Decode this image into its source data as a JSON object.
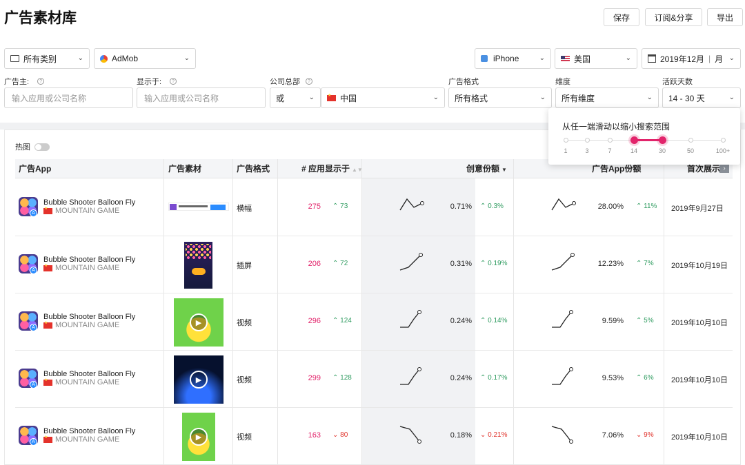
{
  "page_title": "广告素材库",
  "toolbar": {
    "save": "保存",
    "subscribe": "订阅&分享",
    "export": "导出"
  },
  "filters": {
    "category": "所有类别",
    "network": "AdMob",
    "device": "iPhone",
    "country": "美国",
    "date": "2019年12月",
    "date_unit": "月",
    "advertiser_label": "广告主:",
    "advertiser_placeholder": "输入应用或公司名称",
    "shown_in_label": "显示于:",
    "shown_in_placeholder": "输入应用或公司名称",
    "hq_label": "公司总部",
    "hq_op": "或",
    "hq_country": "中国",
    "format_label": "广告格式",
    "format_value": "所有格式",
    "dimension_label": "维度",
    "dimension_value": "所有维度",
    "active_days_label": "活跃天数",
    "active_days_value": "14 - 30 天"
  },
  "popup": {
    "title": "从任一端滑动以缩小搜索范围",
    "ticks": [
      "1",
      "3",
      "7",
      "14",
      "30",
      "50",
      "100+"
    ],
    "selected_min": "14",
    "selected_max": "30",
    "accent": "#e2246b"
  },
  "heatmap": {
    "label": "热图",
    "on": false
  },
  "table": {
    "headers": {
      "app": "广告App",
      "creative": "广告素材",
      "format": "广告格式",
      "apps_shown": "# 应用显示于",
      "share": "创意份额",
      "app_share": "广告App份额",
      "first_seen": "首次展示"
    },
    "rows": [
      {
        "app": "Bubble Shooter Balloon Fly",
        "developer": "MOUNTAIN GAME",
        "creative": "banner",
        "format": "横幅",
        "apps_shown": "275",
        "apps_delta": "73",
        "apps_trend": "up",
        "share": "0.71%",
        "share_delta": "0.3%",
        "share_trend": "up",
        "app_share": "28.00%",
        "app_share_delta": "11%",
        "app_share_trend": "up",
        "first_seen": "2019年9月27日",
        "spark": "mixed"
      },
      {
        "app": "Bubble Shooter Balloon Fly",
        "developer": "MOUNTAIN GAME",
        "creative": "interstitial",
        "format": "插屏",
        "apps_shown": "206",
        "apps_delta": "72",
        "apps_trend": "up",
        "share": "0.31%",
        "share_delta": "0.19%",
        "share_trend": "up",
        "app_share": "12.23%",
        "app_share_delta": "7%",
        "app_share_trend": "up",
        "first_seen": "2019年10月19日",
        "spark": "rise"
      },
      {
        "app": "Bubble Shooter Balloon Fly",
        "developer": "MOUNTAIN GAME",
        "creative": "video-duck",
        "format": "视频",
        "apps_shown": "296",
        "apps_delta": "124",
        "apps_trend": "up",
        "share": "0.24%",
        "share_delta": "0.14%",
        "share_trend": "up",
        "app_share": "9.59%",
        "app_share_delta": "5%",
        "app_share_trend": "up",
        "first_seen": "2019年10月10日",
        "spark": "rise2"
      },
      {
        "app": "Bubble Shooter Balloon Fly",
        "developer": "MOUNTAIN GAME",
        "creative": "video-night",
        "format": "视频",
        "apps_shown": "299",
        "apps_delta": "128",
        "apps_trend": "up",
        "share": "0.24%",
        "share_delta": "0.17%",
        "share_trend": "up",
        "app_share": "9.53%",
        "app_share_delta": "6%",
        "app_share_trend": "up",
        "first_seen": "2019年10月10日",
        "spark": "rise2"
      },
      {
        "app": "Bubble Shooter Balloon Fly",
        "developer": "MOUNTAIN GAME",
        "creative": "video-duck",
        "format": "视频",
        "apps_shown": "163",
        "apps_delta": "80",
        "apps_trend": "down",
        "share": "0.18%",
        "share_delta": "0.21%",
        "share_trend": "down",
        "app_share": "7.06%",
        "app_share_delta": "9%",
        "app_share_trend": "down",
        "first_seen": "2019年10月10日",
        "spark": "fall"
      }
    ]
  }
}
